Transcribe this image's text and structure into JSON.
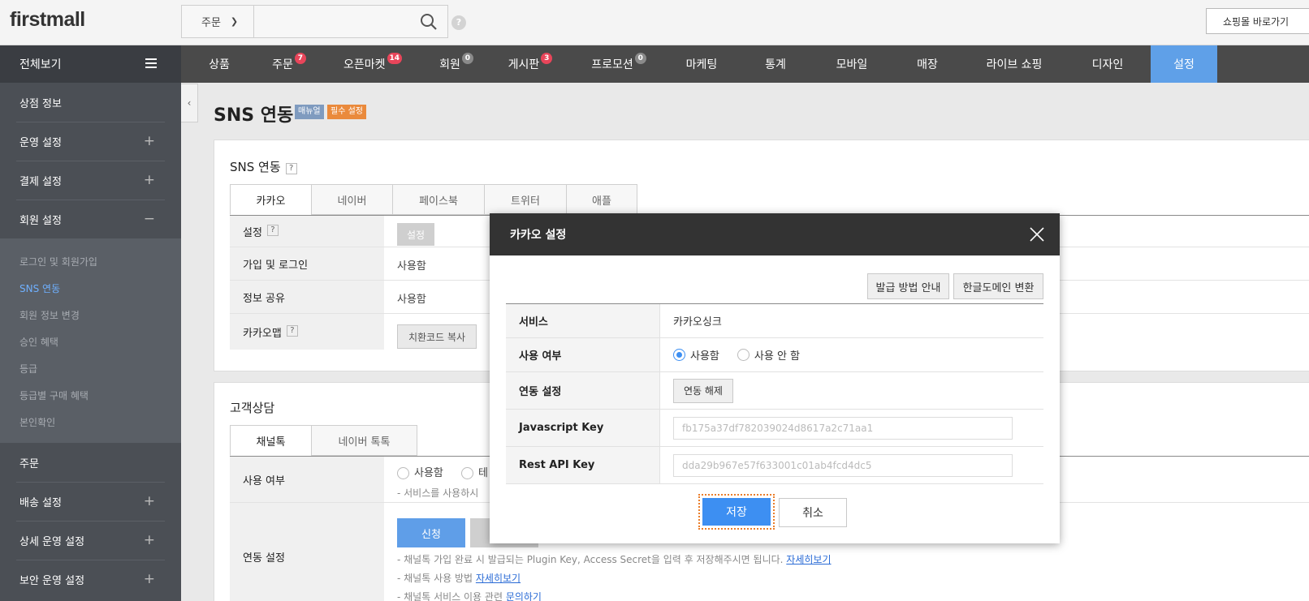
{
  "header": {
    "logo": "firstmall",
    "search_scope": "주문",
    "shop_button": "쇼핑몰 바로가기"
  },
  "nav": {
    "all_label": "전체보기",
    "items": [
      {
        "label": "상품",
        "badge": ""
      },
      {
        "label": "주문",
        "badge": "7",
        "badge_color": "#e8455a"
      },
      {
        "label": "오픈마켓",
        "badge": "14",
        "badge_color": "#e8455a"
      },
      {
        "label": "회원",
        "badge": "0",
        "badge_color": "#8a8a8a"
      },
      {
        "label": "게시판",
        "badge": "3",
        "badge_color": "#e8455a"
      },
      {
        "label": "프로모션",
        "badge": "0",
        "badge_color": "#8a8a8a"
      },
      {
        "label": "마케팅",
        "badge": ""
      },
      {
        "label": "통계",
        "badge": ""
      },
      {
        "label": "모바일",
        "badge": ""
      },
      {
        "label": "매장",
        "badge": ""
      },
      {
        "label": "라이브 쇼핑",
        "badge": ""
      },
      {
        "label": "디자인",
        "badge": ""
      },
      {
        "label": "설정",
        "badge": "",
        "active": true
      }
    ]
  },
  "sidebar": {
    "items": [
      {
        "label": "상점 정보",
        "sign": ""
      },
      {
        "label": "운영 설정",
        "sign": "+"
      },
      {
        "label": "결제 설정",
        "sign": "+"
      },
      {
        "label": "회원 설정",
        "sign": "−"
      },
      {
        "label": "주문",
        "sign": ""
      },
      {
        "label": "배송 설정",
        "sign": "+"
      },
      {
        "label": "상세 운영 설정",
        "sign": "+"
      },
      {
        "label": "보안 운영 설정",
        "sign": "+"
      }
    ],
    "sub_items": [
      {
        "label": "로그인 및 회원가입"
      },
      {
        "label": "SNS 연동",
        "active": true
      },
      {
        "label": "회원 정보 변경"
      },
      {
        "label": "승인 혜택"
      },
      {
        "label": "등급"
      },
      {
        "label": "등급별 구매 혜택"
      },
      {
        "label": "본인확인"
      }
    ]
  },
  "page": {
    "title": "SNS 연동",
    "tag_manual": "매뉴얼",
    "tag_required": "필수 설정"
  },
  "sns_panel": {
    "title": "SNS 연동",
    "tabs": [
      "카카오",
      "네이버",
      "페이스북",
      "트위터",
      "애플"
    ],
    "rows": [
      {
        "label": "설정",
        "value": "설정"
      },
      {
        "label": "가입 및 로그인",
        "value": "사용함"
      },
      {
        "label": "정보 공유",
        "value": "사용함"
      },
      {
        "label": "카카오맵",
        "value": "치환코드 복사"
      }
    ]
  },
  "consult_panel": {
    "title": "고객상담",
    "tabs": [
      "채널톡",
      "네이버 톡톡"
    ],
    "use_label": "사용 여부",
    "use_option1": "사용함",
    "use_option2": "테",
    "use_hint": "- 서비스를 사용하시",
    "link_label": "연동 설정",
    "apply_btn": "신청",
    "hint1": "- 채널톡 가입 완료 시 발급되는 Plugin Key, Access Secret을 입력 후 저장해주시면 됩니다. ",
    "hint1_link": "자세히보기",
    "hint2": "- 채널톡 사용 방법 ",
    "hint2_link": "자세히보기",
    "hint3": "- 채널톡 서비스 이용 관련 ",
    "hint3_link": "문의하기"
  },
  "modal": {
    "title": "카카오 설정",
    "btn_guide": "발급 방법 안내",
    "btn_domain": "한글도메인 변환",
    "service_label": "서비스",
    "service_value": "카카오싱크",
    "use_label": "사용 여부",
    "use_on": "사용함",
    "use_off": "사용 안 함",
    "link_label": "연동 설정",
    "unlink_btn": "연동 해제",
    "js_key_label": "Javascript Key",
    "js_key_value": "fb175a37df782039024d8617a2c71aa1",
    "rest_key_label": "Rest API Key",
    "rest_key_value": "dda29b967e57f633001c01ab4fcd4dc5",
    "save": "저장",
    "cancel": "취소"
  }
}
